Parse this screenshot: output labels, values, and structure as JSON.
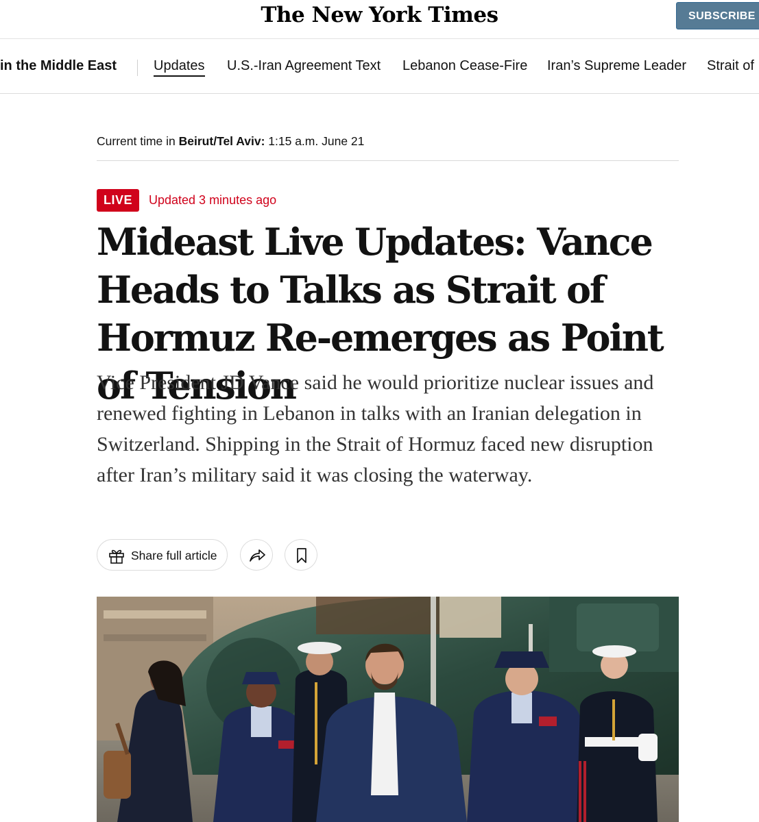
{
  "masthead": {
    "logo_text": "The New York Times",
    "subscribe_label": "SUBSCRIBE"
  },
  "topic_nav": {
    "title": "in the Middle East",
    "items": [
      "Updates",
      "U.S.-Iran Agreement Text",
      "Lebanon Cease-Fire",
      "Iran’s Supreme Leader",
      "Strait of"
    ]
  },
  "time_bar": {
    "prefix": "Current time in",
    "location": "Beirut/Tel Aviv:",
    "time": "1:15 a.m. June 21"
  },
  "article": {
    "live_label": "LIVE",
    "updated": "Updated 3 minutes ago",
    "headline": "Mideast Live Updates: Vance Heads to Talks as Strait of Hormuz Re-emerges as Point of Tension",
    "summary": "Vice President JD Vance said he would prioritize nuclear issues and renewed fighting in Lebanon in talks with an Iranian delegation in Switzerland. Shipping in the Strait of Hormuz faced new disruption after Iran’s military said it was closing the waterway."
  },
  "share": {
    "share_full_label": "Share full article"
  },
  "icons": {
    "gift": "gift-icon",
    "share": "share-arrow-icon",
    "bookmark": "bookmark-icon"
  },
  "colors": {
    "live_red": "#d0021b",
    "subscribe_blue": "#567b95"
  }
}
